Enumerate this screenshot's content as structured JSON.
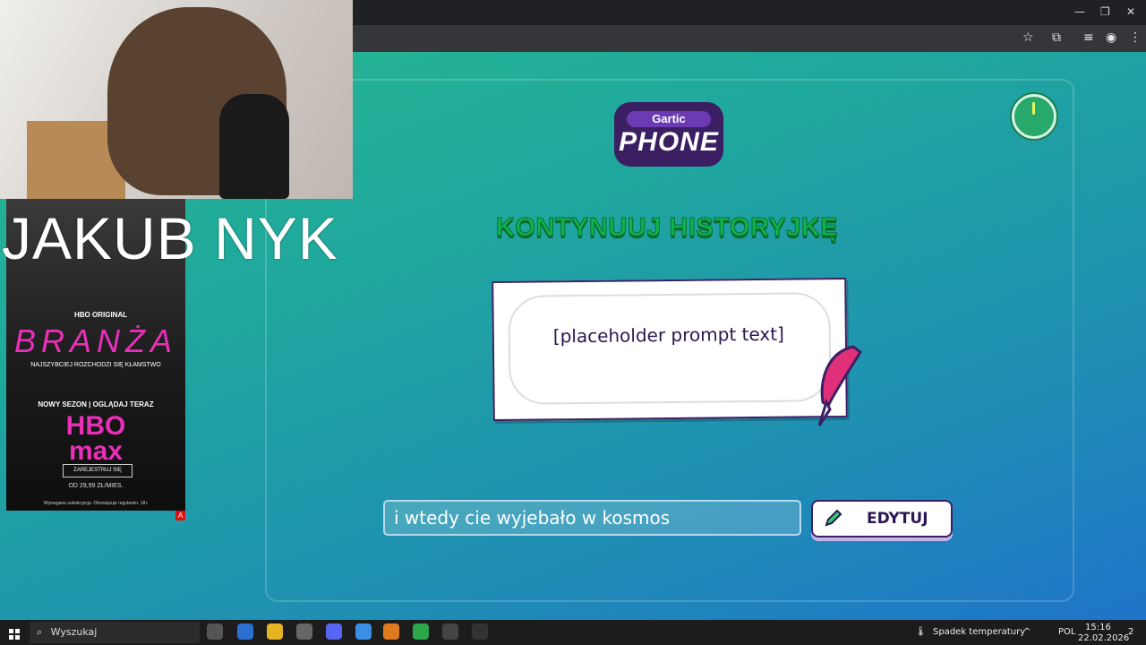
{
  "window_controls": {
    "minimize": "—",
    "restore": "❐",
    "close": "✕"
  },
  "address_icons": {
    "star": "☆",
    "extensions": "⧉",
    "media": "≡",
    "profile": "◉",
    "menu": "⋮"
  },
  "game": {
    "logo_top": "Gartic",
    "logo_main": "PHONE",
    "title": "KONTYNUUJ HISTORYJKĘ",
    "prompt_text": "[placeholder prompt text]",
    "input_value": "i wtedy cie wyjebało w kosmos",
    "edit_button_label": "EDYTUJ"
  },
  "overlay": {
    "name": "JAKUB NYK"
  },
  "ad": {
    "hbo_original": "HBO ORIGINAL",
    "title": "BRANŻA",
    "subtitle": "NAJSZYBCIEJ ROZCHODZI SIĘ KŁAMSTWO",
    "cta": "NOWY SEZON | OGLĄDAJ TERAZ",
    "brand_line1": "HBO",
    "brand_line2": "max",
    "register": "ZAREJESTRUJ SIĘ",
    "price": "OD 29,99 ZŁ/MIES.",
    "fine_print": "Wymagana subskrypcja. Obowiązuje regulamin. 18+",
    "badge": "A"
  },
  "taskbar": {
    "search_placeholder": "Wyszukaj",
    "weather": "Spadek temperatury",
    "language": "POL",
    "time": "15:16",
    "date": "22.02.2026",
    "notifications": "2"
  }
}
